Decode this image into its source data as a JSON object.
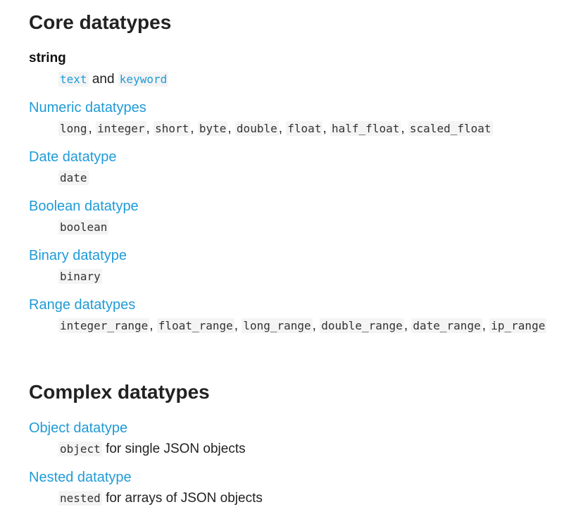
{
  "core": {
    "heading": "Core datatypes",
    "string": {
      "term": "string",
      "text_code": "text",
      "and": "and",
      "keyword_code": "keyword"
    },
    "numeric": {
      "term": "Numeric datatypes",
      "codes": [
        "long",
        "integer",
        "short",
        "byte",
        "double",
        "float",
        "half_float",
        "scaled_float"
      ]
    },
    "date": {
      "term": "Date datatype",
      "code": "date"
    },
    "boolean": {
      "term": "Boolean datatype",
      "code": "boolean"
    },
    "binary": {
      "term": "Binary datatype",
      "code": "binary"
    },
    "range": {
      "term": "Range datatypes",
      "codes": [
        "integer_range",
        "float_range",
        "long_range",
        "double_range",
        "date_range",
        "ip_range"
      ]
    }
  },
  "complex": {
    "heading": "Complex datatypes",
    "object": {
      "term": "Object datatype",
      "code": "object",
      "desc": "for single JSON objects"
    },
    "nested": {
      "term": "Nested datatype",
      "code": "nested",
      "desc": "for arrays of JSON objects"
    }
  },
  "separator": ",",
  "colors": {
    "link": "#1f9bd7",
    "text": "#222222",
    "code_bg": "#f4f4f4"
  }
}
